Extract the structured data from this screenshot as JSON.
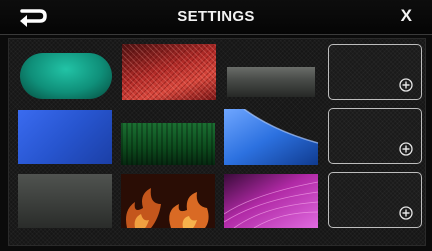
{
  "header": {
    "title": "SETTINGS",
    "close_label": "X"
  },
  "backgrounds": [
    {
      "name": "green-teal",
      "color": "#0f8f79"
    },
    {
      "name": "red-mesh",
      "color": "#b12a27"
    },
    {
      "name": "gray-metal",
      "color": "#4a4d4a"
    },
    {
      "name": "blue",
      "color": "#2755cf"
    },
    {
      "name": "dark-green",
      "color": "#0c4a1c"
    },
    {
      "name": "blue-wave",
      "color": "#2c71e0"
    },
    {
      "name": "dark-gray",
      "color": "#3d403d"
    },
    {
      "name": "fire",
      "color": "#c4561c"
    },
    {
      "name": "magenta",
      "color": "#b029a5"
    }
  ],
  "custom_slots": [
    {
      "icon": "plus-circle-icon"
    },
    {
      "icon": "plus-circle-icon"
    },
    {
      "icon": "plus-circle-icon"
    }
  ]
}
